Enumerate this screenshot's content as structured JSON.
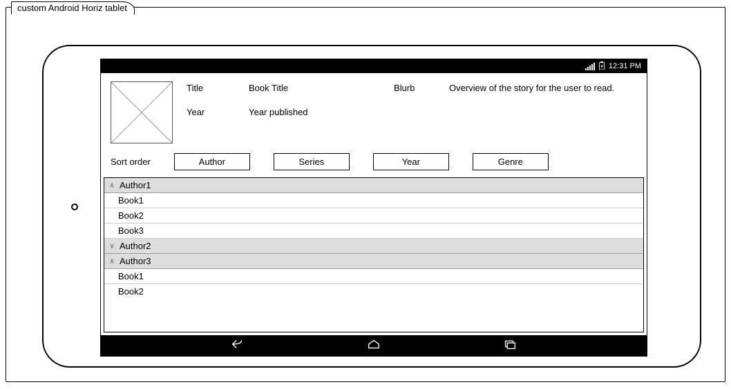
{
  "frame_label": "custom Android Horiz tablet",
  "status": {
    "time": "12:31 PM"
  },
  "detail": {
    "title_label": "Title",
    "title_value": "Book Title",
    "year_label": "Year",
    "year_value": "Year published",
    "blurb_label": "Blurb",
    "blurb_value": "Overview of the story for the user to read."
  },
  "sort": {
    "label": "Sort order",
    "buttons": [
      "Author",
      "Series",
      "Year",
      "Genre"
    ]
  },
  "groups": [
    {
      "name": "Author1",
      "expanded": true,
      "books": [
        "Book1",
        "Book2",
        "Book3"
      ]
    },
    {
      "name": "Author2",
      "expanded": false,
      "books": []
    },
    {
      "name": "Author3",
      "expanded": true,
      "books": [
        "Book1",
        "Book2"
      ]
    }
  ]
}
